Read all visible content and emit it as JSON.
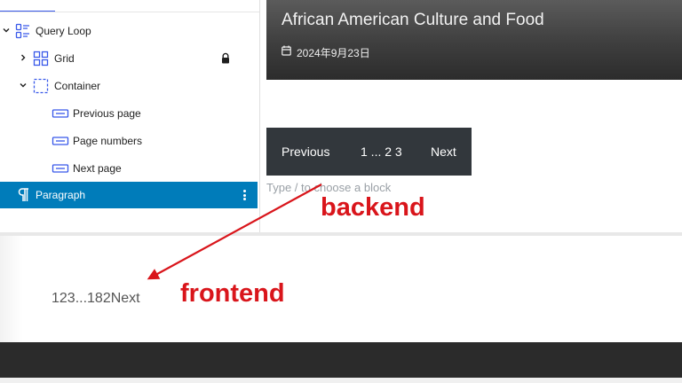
{
  "list_view": {
    "items": [
      {
        "label": "Query Loop",
        "icon": "query-loop-icon"
      },
      {
        "label": "Grid",
        "icon": "grid-icon",
        "locked": true
      },
      {
        "label": "Container",
        "icon": "container-icon"
      },
      {
        "label": "Previous page",
        "icon": "pagination-previous-icon"
      },
      {
        "label": "Page numbers",
        "icon": "pagination-numbers-icon"
      },
      {
        "label": "Next page",
        "icon": "pagination-next-icon"
      },
      {
        "label": "Paragraph",
        "icon": "paragraph-icon",
        "selected": true
      }
    ]
  },
  "canvas": {
    "post_title": "African American Culture and Food",
    "post_date": "2024年9月23日",
    "pagination": {
      "previous": "Previous",
      "numbers": "1 ... 2 3",
      "next": "Next"
    },
    "block_appender": "Type / to choose a block"
  },
  "annotations": {
    "backend": "backend",
    "frontend": "frontend"
  },
  "frontend": {
    "pagination_text": "123...182Next"
  },
  "colors": {
    "selected_bg": "#007cba",
    "accent": "#3858e9",
    "annotation": "#d9151b",
    "pagination_bg": "#32373c"
  }
}
